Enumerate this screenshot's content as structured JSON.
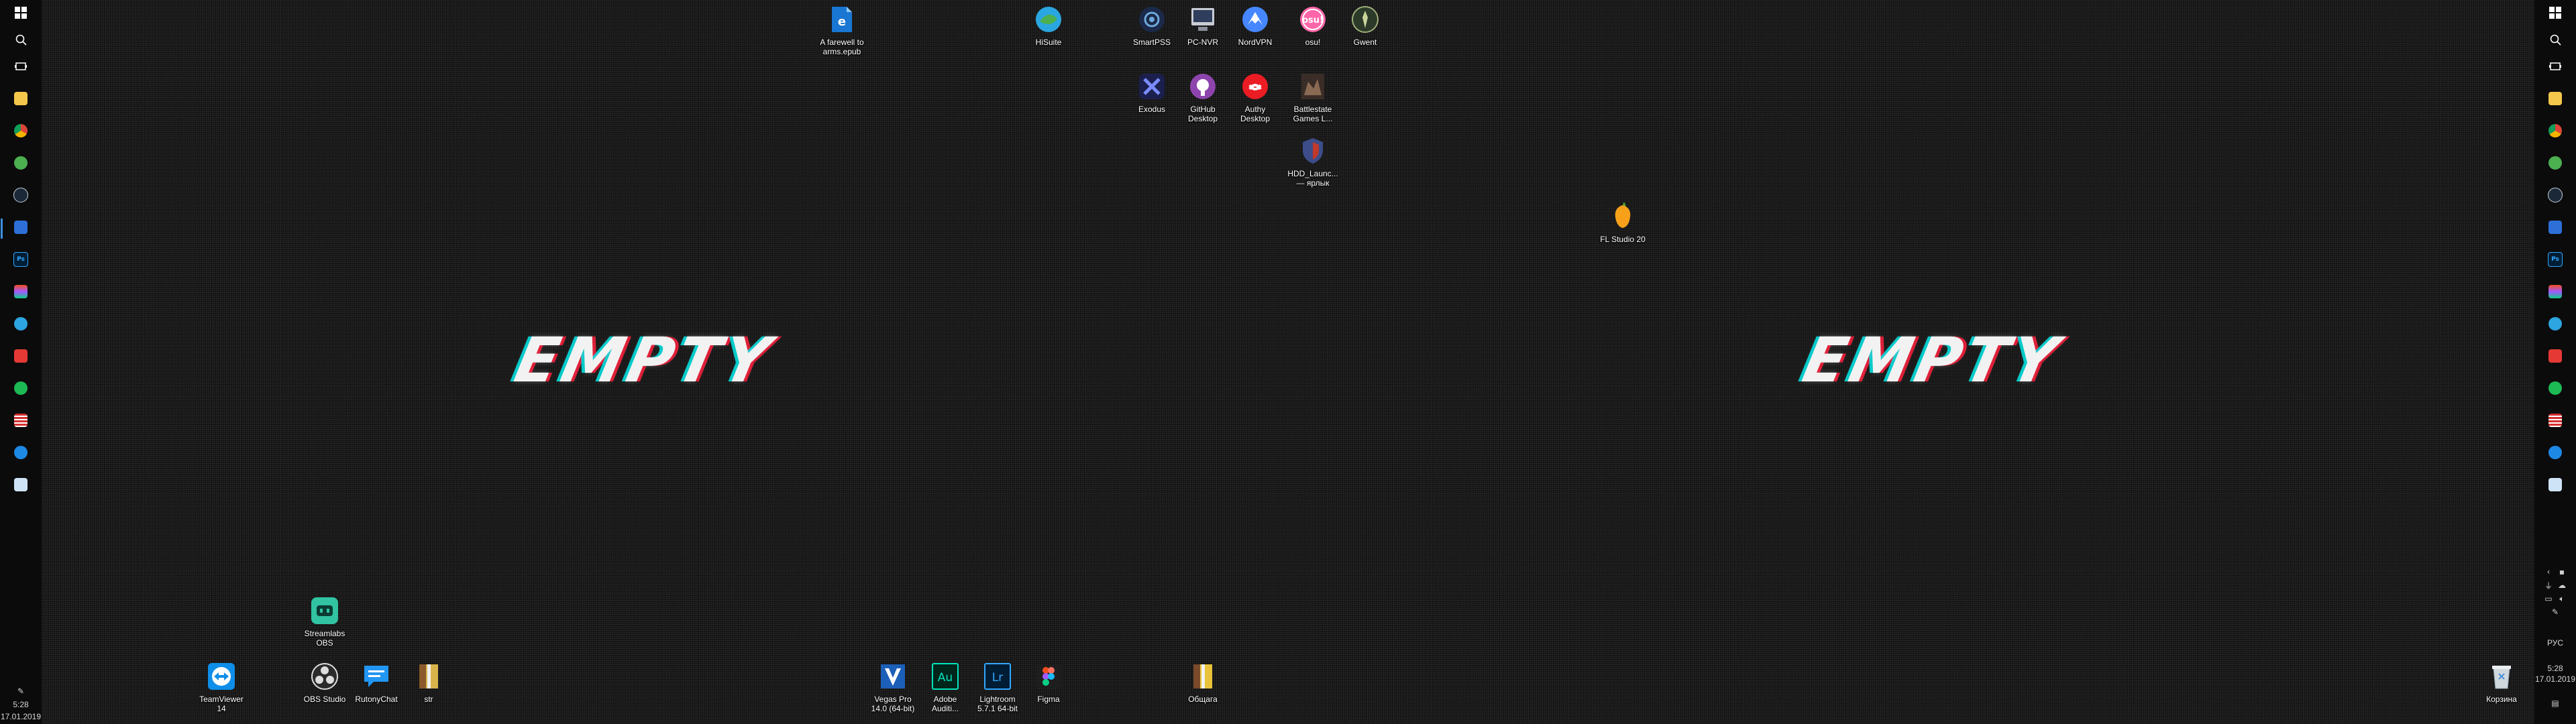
{
  "wallpaper": {
    "text_left": "EMPTY",
    "text_right": "EMPTY"
  },
  "desktop_icons": {
    "farewell": "A farewell to\narms.epub",
    "hisuite": "HiSuite",
    "smartpss": "SmartPSS",
    "pcnvr": "PC-NVR",
    "nordvpn": "NordVPN",
    "osu": "osu!",
    "gwent": "Gwent",
    "exodus": "Exodus",
    "github": "GitHub\nDesktop",
    "authy": "Authy\nDesktop",
    "battlestate": "Battlestate\nGames L...",
    "hdd": "HDD_Launc...\n— ярлык",
    "flstudio": "FL Studio 20",
    "streamlabs": "Streamlabs\nOBS",
    "teamviewer": "TeamViewer\n14",
    "obs": "OBS Studio",
    "rutony": "RutonyChat",
    "str": "str",
    "vegas": "Vegas Pro\n14.0 (64-bit)",
    "audition": "Adobe\nAuditi...",
    "lightroom": "Lightroom\n5.7.1 64-bit",
    "figma": "Figma",
    "obshaga": "Общага",
    "recycle": "Корзина"
  },
  "taskbar_left": {
    "time": "5:28",
    "date": "17.01.2019"
  },
  "taskbar_right": {
    "lang": "РУС",
    "time": "5:28",
    "date": "17.01.2019"
  },
  "colors": {
    "accent": "#3b8fe0",
    "taskbar": "#0b0b0b",
    "glitch_cyan": "#00e6e6",
    "glitch_red": "#ff1e3c"
  }
}
